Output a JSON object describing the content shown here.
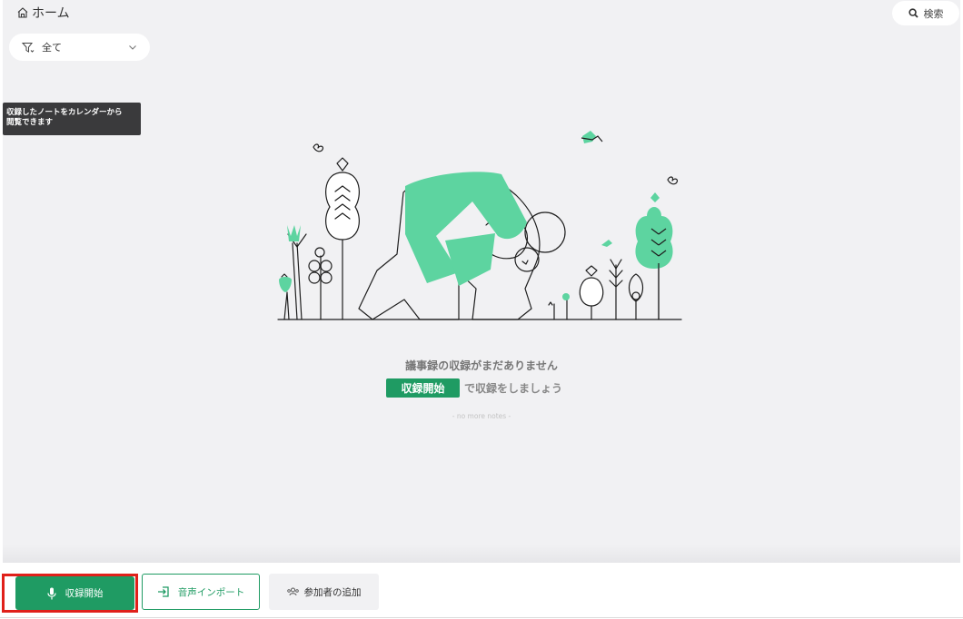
{
  "header": {
    "home_label": "ホーム",
    "home_icon": "home-icon",
    "search_label": "検索",
    "search_icon": "search-icon"
  },
  "filter": {
    "icon": "filter-icon",
    "selected": "全て",
    "chevron_icon": "chevron-down-icon"
  },
  "tooltip": {
    "line1": "収録したノートをカレンダーから",
    "line2": "閲覧できます"
  },
  "empty_state": {
    "title": "議事録の収録がまだありません",
    "cta_chip": "収録開始",
    "cta_suffix": "で収録をしましょう",
    "no_more_notes": "- no more notes -"
  },
  "bottom_bar": {
    "record_label": "収録開始",
    "record_icon": "microphone-icon",
    "import_label": "音声インポート",
    "import_icon": "import-icon",
    "participants_label": "参加者の追加",
    "participants_icon": "people-icon"
  },
  "colors": {
    "accent": "#1f9b63",
    "illustration_green": "#5dd4a0",
    "highlight": "#e0201a",
    "tooltip_bg": "#3a3a3c"
  }
}
